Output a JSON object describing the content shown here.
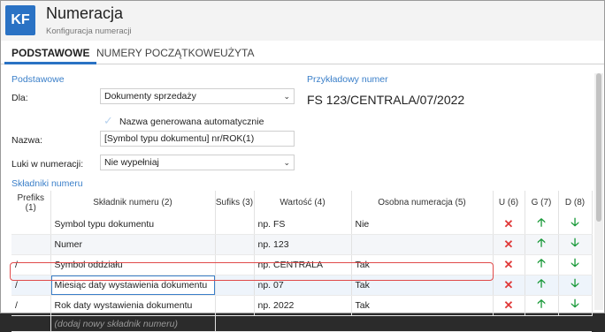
{
  "app": {
    "logo": "KF",
    "title": "Numeracja",
    "subtitle": "Konfiguracja numeracji"
  },
  "tabs": [
    {
      "label": "PODSTAWOWE",
      "active": true
    },
    {
      "label": "NUMERY POCZĄTKOWE",
      "active": false
    },
    {
      "label": "UŻYTA",
      "active": false
    }
  ],
  "basic": {
    "section": "Podstawowe",
    "for_label": "Dla:",
    "for_value": "Dokumenty sprzedaży",
    "auto_label": "Nazwa generowana automatycznie",
    "name_label": "Nazwa:",
    "name_value": "[Symbol typu dokumentu] nr/ROK(1)",
    "gaps_label": "Luki w numeracji:",
    "gaps_value": "Nie wypełniaj"
  },
  "example": {
    "section": "Przykładowy numer",
    "value": "FS 123/CENTRALA/07/2022"
  },
  "components": {
    "section": "Składniki numeru",
    "headers": {
      "prefix": "Prefiks (1)",
      "component": "Składnik numeru (2)",
      "suffix": "Sufiks (3)",
      "value": "Wartość (4)",
      "separate": "Osobna numeracja (5)",
      "u": "U (6)",
      "g": "G (7)",
      "d": "D (8)"
    },
    "rows": [
      {
        "prefix": "",
        "component": "Symbol typu dokumentu",
        "suffix": "",
        "value": "np. FS",
        "separate": "Nie"
      },
      {
        "prefix": "",
        "component": "Numer",
        "suffix": "",
        "value": "np. 123",
        "separate": ""
      },
      {
        "prefix": "/",
        "component": "Symbol oddziału",
        "suffix": "",
        "value": "np. CENTRALA",
        "separate": "Tak"
      },
      {
        "prefix": "/",
        "component": "Miesiąc daty wystawienia dokumentu",
        "suffix": "",
        "value": "np. 07",
        "separate": "Tak"
      },
      {
        "prefix": "/",
        "component": "Rok daty wystawienia dokumentu",
        "suffix": "",
        "value": "np. 2022",
        "separate": "Tak"
      }
    ],
    "add_placeholder": "(dodaj nowy składnik numeru)"
  },
  "colors": {
    "accent": "#2a72c4",
    "delete": "#e03a3a",
    "move": "#1a9a3a",
    "highlight": "#e04a4a"
  },
  "icons": {
    "delete": "x-icon",
    "up": "arrow-up-icon",
    "down": "arrow-down-icon",
    "dropdown": "chevron-down-icon",
    "check": "checkmark-icon"
  }
}
